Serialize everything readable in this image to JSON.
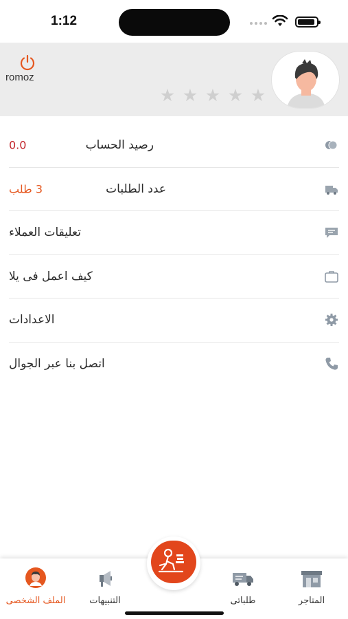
{
  "status_bar": {
    "time": "1:12"
  },
  "header": {
    "username": "romoz",
    "rating": {
      "filled": 0,
      "total": 5
    }
  },
  "menu": {
    "items": [
      {
        "label": "رصيد الحساب",
        "value": "0.0",
        "icon": "coins-icon"
      },
      {
        "label": "عدد الطلبات",
        "value": "3 طلب",
        "icon": "delivery-truck-icon"
      },
      {
        "label": "تعليقات العملاء",
        "icon": "chat-bubble-icon"
      },
      {
        "label": "كيف اعمل فى يلا",
        "icon": "briefcase-icon"
      },
      {
        "label": "الاعدادات",
        "icon": "gear-icon"
      },
      {
        "label": "اتصل بنا عبر الجوال",
        "icon": "phone-icon"
      }
    ]
  },
  "bottom_nav": {
    "items": [
      {
        "label": "الملف الشخصى",
        "icon": "profile-avatar-icon",
        "active": true
      },
      {
        "label": "التنبيهات",
        "icon": "megaphone-icon",
        "active": false
      },
      {
        "label": "طلباتى",
        "icon": "delivery-truck-icon",
        "active": false
      },
      {
        "label": "المتاجر",
        "icon": "store-icon",
        "active": false
      }
    ],
    "center_action": {
      "icon": "delivery-person-icon"
    }
  },
  "colors": {
    "accent": "#e2461c",
    "balance_value": "#c2252b",
    "orders_value": "#e5571f",
    "header_bg": "#ececec"
  }
}
